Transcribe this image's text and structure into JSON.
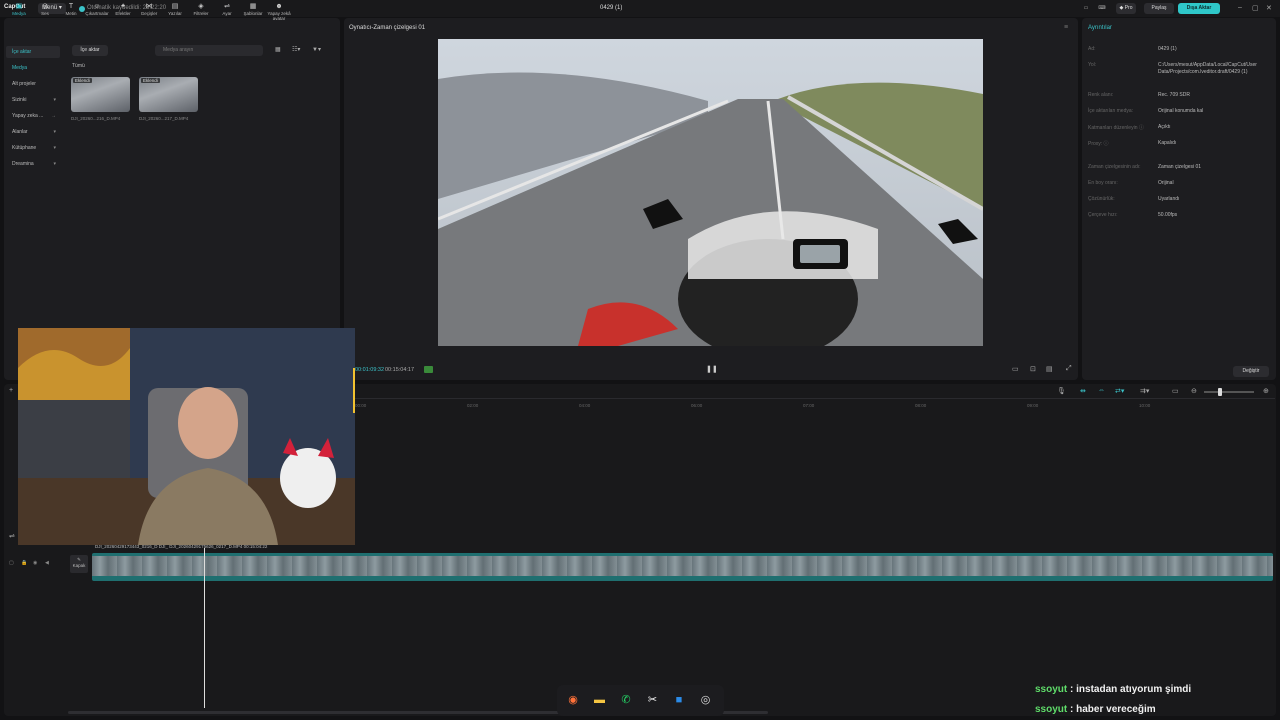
{
  "titlebar": {
    "logo": "CapCut",
    "menu_label": "Menü",
    "autosave": "Otomatik kaydedildi: 23:22:20",
    "doc_title": "0429 (1)",
    "pro_label": "Pro",
    "share_label": "Paylaş",
    "export_label": "Dışa Aktar"
  },
  "toolbar": [
    {
      "icon": "media-icon",
      "label": "Medya"
    },
    {
      "icon": "audio-icon",
      "label": "Ses"
    },
    {
      "icon": "text-icon",
      "label": "Metin"
    },
    {
      "icon": "stickers-icon",
      "label": "Çıkartmalar"
    },
    {
      "icon": "effects-icon",
      "label": "Efektler"
    },
    {
      "icon": "transitions-icon",
      "label": "Geçişler"
    },
    {
      "icon": "captions-icon",
      "label": "Yazılar"
    },
    {
      "icon": "filters-icon",
      "label": "Filtreler"
    },
    {
      "icon": "adjust-icon",
      "label": "Ayar"
    },
    {
      "icon": "templates-icon",
      "label": "Şablonlar"
    },
    {
      "icon": "ai-avatar-icon",
      "label": "Yapay zekâ avatar"
    }
  ],
  "sidebar": {
    "items": [
      {
        "label": "İçe aktar",
        "chev": ""
      },
      {
        "label": "Medya",
        "chev": ""
      },
      {
        "label": "Alt projeler",
        "chev": ""
      },
      {
        "label": "Sizinki",
        "chev": "▾"
      },
      {
        "label": "Yapay zeka ...",
        "chev": "→"
      },
      {
        "label": "Alanlar",
        "chev": "▾"
      },
      {
        "label": "Kütüphane",
        "chev": "▾"
      },
      {
        "label": "Dreamina",
        "chev": "▾"
      }
    ]
  },
  "media": {
    "import_label": "İçe aktar",
    "search_placeholder": "Medya arayın",
    "all_label": "Tümü",
    "clips": [
      {
        "badge": "Eklendi",
        "name": "DJI_20260...216_D.MP4"
      },
      {
        "badge": "Eklendi",
        "name": "DJI_20260...217_D.MP4"
      }
    ]
  },
  "player": {
    "title": "Oynatıcı-Zaman çizelgesi 01",
    "time_current": "00:01:09:32",
    "time_total": "00:15:04:17"
  },
  "details": {
    "title": "Ayrıntılar",
    "rows": [
      {
        "label": "Ad:",
        "value": "0429 (1)"
      },
      {
        "label": "Yol:",
        "value": "C:/Users/mesut/AppData/Local/CapCut/User Data/Projects/com.lveditor.draft/0429 (1)"
      },
      {
        "label": "Renk alanı:",
        "value": "Rec. 709 SDR"
      },
      {
        "label": "İçe aktarılan medya:",
        "value": "Orijinal konumda kal"
      },
      {
        "label": "Katmanları düzenleyin ⓘ",
        "value": "Açıktı"
      },
      {
        "label": "Proxy: ⓘ",
        "value": "Kapalıdı"
      },
      {
        "label": "Zaman çizelgesinin adı:",
        "value": "Zaman çizelgesi 01"
      },
      {
        "label": "En boy oranı:",
        "value": "Orijinal"
      },
      {
        "label": "Çözünürlük:",
        "value": "Uyarlandı"
      },
      {
        "label": "Çerçeve hızı:",
        "value": "50.00fps"
      }
    ],
    "change_label": "Değiştir"
  },
  "timeline": {
    "ruler": [
      "00:00",
      "02:00",
      "04:00",
      "06:00",
      "07:00",
      "08:00",
      "09:00",
      "10:00"
    ],
    "clip_label": "DJI_20260429173443_0216_D  DJI_  DJI_20260429175626_0217_D.MP4  00:15:04:22",
    "cover_label": "Kapak"
  },
  "taskbar": [
    {
      "icon": "firefox-icon",
      "glyph": "◉",
      "color": "#ff7139"
    },
    {
      "icon": "file-explorer-icon",
      "glyph": "▬",
      "color": "#f5c542"
    },
    {
      "icon": "whatsapp-icon",
      "glyph": "✆",
      "color": "#25d366"
    },
    {
      "icon": "capcut-icon",
      "glyph": "✂",
      "color": "#ffffff"
    },
    {
      "icon": "windows-store-icon",
      "glyph": "■",
      "color": "#2b8be8"
    },
    {
      "icon": "obs-icon",
      "glyph": "◎",
      "color": "#dddddd"
    }
  ],
  "chat": [
    {
      "user": "ssoyut",
      "sep": " : ",
      "message": "instadan atıyorum şimdi"
    },
    {
      "user": "ssoyut",
      "sep": " : ",
      "message": "haber vereceğim"
    }
  ]
}
